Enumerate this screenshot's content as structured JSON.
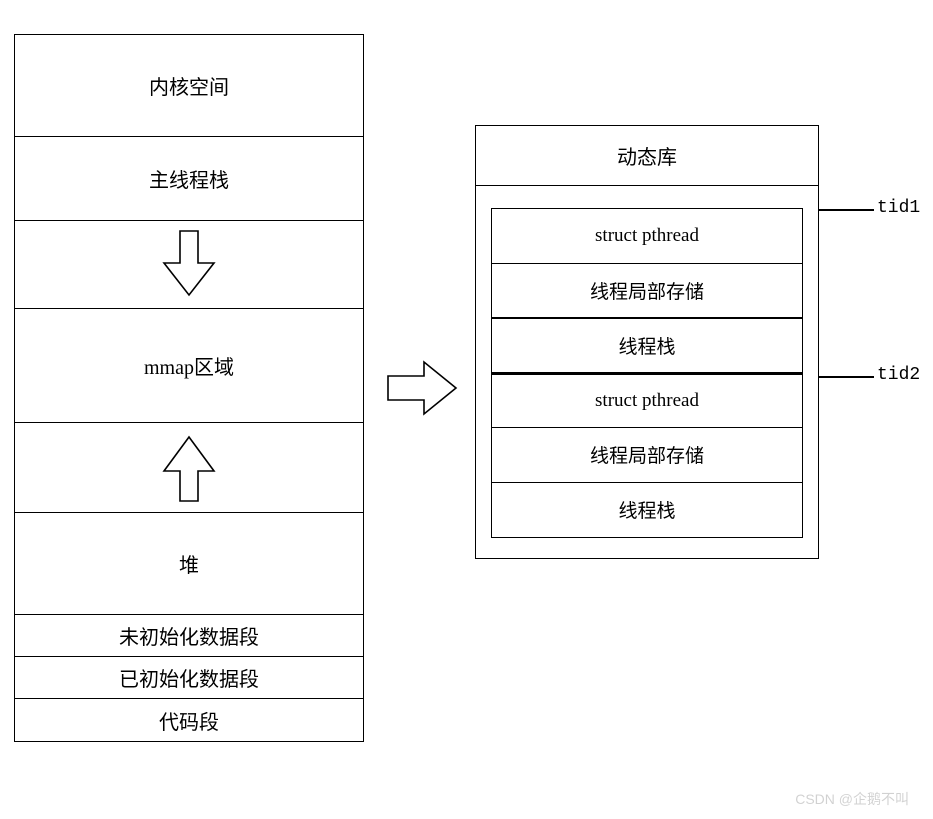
{
  "left": {
    "kernel": "内核空间",
    "main_stack": "主线程栈",
    "mmap": "mmap区域",
    "heap": "堆",
    "bss": "未初始化数据段",
    "data_seg": "已初始化数据段",
    "text_seg": "代码段"
  },
  "right": {
    "header": "动态库",
    "rows": [
      "struct pthread",
      "线程局部存储",
      "线程栈",
      "struct pthread",
      "线程局部存储",
      "线程栈"
    ]
  },
  "labels": {
    "tid1": "tid1",
    "tid2": "tid2"
  },
  "watermark": "CSDN @企鹅不叫"
}
